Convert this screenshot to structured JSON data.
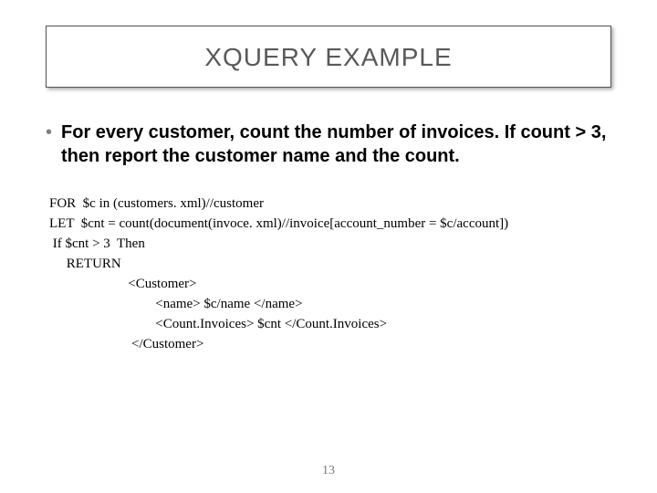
{
  "title": "XQUERY EXAMPLE",
  "bullet": "For every customer, count the number of invoices. If count > 3, then report the customer name and the count.",
  "code": "FOR  $c in (customers. xml)//customer\nLET  $cnt = count(document(invoce. xml)//invoice[account_number = $c/account])\n If $cnt > 3  Then\n     RETURN\n                       <Customer>\n                               <name> $c/name </name>\n                               <Count.Invoices> $cnt </Count.Invoices>\n                        </Customer>",
  "page_number": "13"
}
